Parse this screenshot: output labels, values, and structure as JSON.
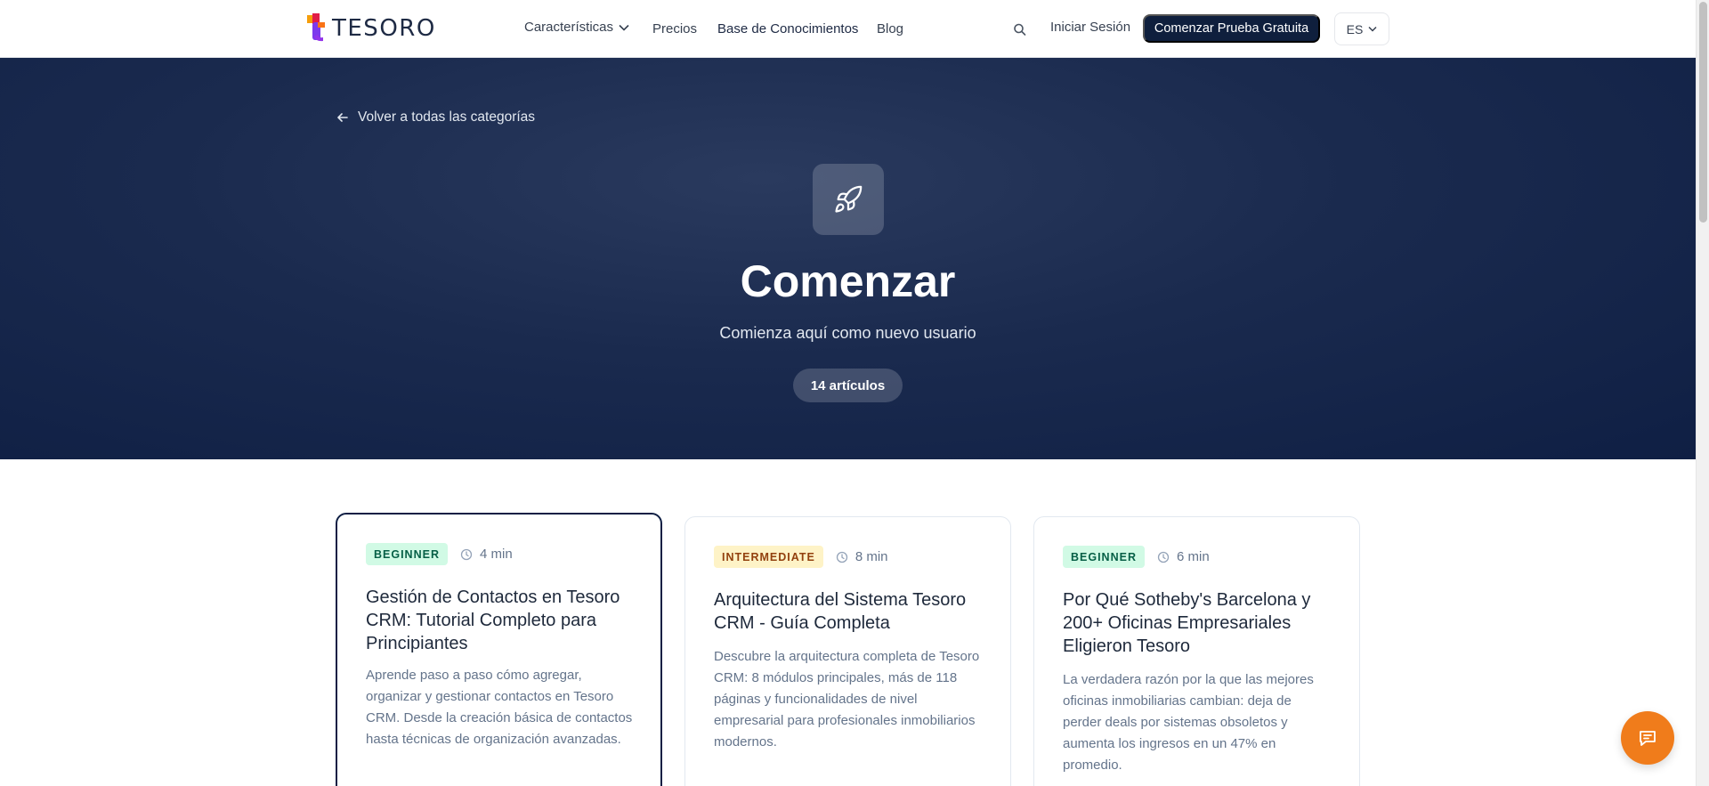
{
  "navbar": {
    "logo_text": "TESORO",
    "links": [
      {
        "label": "Características"
      },
      {
        "label": "Precios"
      },
      {
        "label": "Base de Conocimientos"
      },
      {
        "label": "Blog"
      }
    ],
    "login_label": "Iniciar Sesión",
    "cta_label": "Comenzar Prueba Gratuita",
    "language": "ES"
  },
  "hero": {
    "back_label": "Volver a todas las categorías",
    "icon": "rocket-icon",
    "title": "Comenzar",
    "subtitle": "Comienza aquí como nuevo usuario",
    "badge": "14 artículos"
  },
  "cards": [
    {
      "level": "BEGINNER",
      "read_time": "4 min",
      "title": "Gestión de Contactos en Tesoro CRM: Tutorial Completo para Principiantes",
      "description": "Aprende paso a paso cómo agregar, organizar y gestionar contactos en Tesoro CRM. Desde la creación básica de contactos hasta técnicas de organización avanzadas."
    },
    {
      "level": "INTERMEDIATE",
      "read_time": "8 min",
      "title": "Arquitectura del Sistema Tesoro CRM - Guía Completa",
      "description": "Descubre la arquitectura completa de Tesoro CRM: 8 módulos principales, más de 118 páginas y funcionalidades de nivel empresarial para profesionales inmobiliarios modernos."
    },
    {
      "level": "BEGINNER",
      "read_time": "6 min",
      "title": "Por Qué Sotheby's Barcelona y 200+ Oficinas Empresariales Eligieron Tesoro",
      "description": "La verdadera razón por la que las mejores oficinas inmobiliarias cambian: deja de perder deals por sistemas obsoletos y aumenta los ingresos en un 47% en promedio."
    }
  ],
  "colors": {
    "navy": "#0f1f44",
    "accent_orange": "#f07c1b",
    "beginner_bg": "#d1fae5",
    "intermediate_bg": "#fef3c7"
  }
}
